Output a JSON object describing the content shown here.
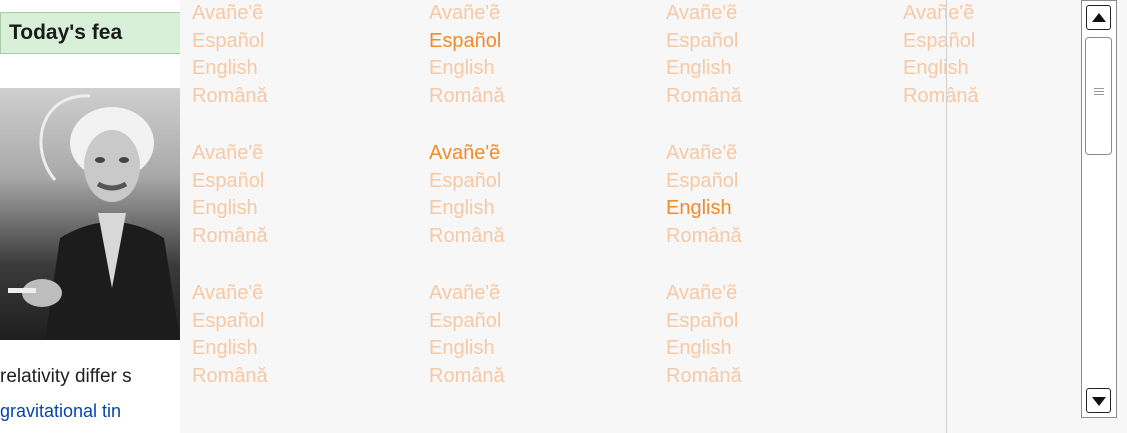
{
  "background": {
    "featured_title": "Today's fea",
    "article_text": "relativity differ s",
    "article_link": "gravitational tin"
  },
  "language_groups": [
    {
      "items": [
        {
          "label": "Avañe'ẽ",
          "active": false
        },
        {
          "label": "Español",
          "active": false
        },
        {
          "label": "English",
          "active": false
        },
        {
          "label": "Română",
          "active": false
        }
      ]
    },
    {
      "items": [
        {
          "label": "Avañe'ẽ",
          "active": false
        },
        {
          "label": "Español",
          "active": true
        },
        {
          "label": "English",
          "active": false
        },
        {
          "label": "Română",
          "active": false
        }
      ]
    },
    {
      "items": [
        {
          "label": "Avañe'ẽ",
          "active": false
        },
        {
          "label": "Español",
          "active": false
        },
        {
          "label": "English",
          "active": false
        },
        {
          "label": "Română",
          "active": false
        }
      ]
    },
    {
      "items": [
        {
          "label": "Avañe'ẽ",
          "active": false
        },
        {
          "label": "Español",
          "active": false
        },
        {
          "label": "English",
          "active": false
        },
        {
          "label": "Română",
          "active": false
        }
      ]
    },
    {
      "items": [
        {
          "label": "Avañe'ẽ",
          "active": false
        },
        {
          "label": "Español",
          "active": false
        },
        {
          "label": "English",
          "active": false
        },
        {
          "label": "Română",
          "active": false
        }
      ]
    },
    {
      "items": [
        {
          "label": "Avañe'ẽ",
          "active": true
        },
        {
          "label": "Español",
          "active": false
        },
        {
          "label": "English",
          "active": false
        },
        {
          "label": "Română",
          "active": false
        }
      ]
    },
    {
      "items": [
        {
          "label": "Avañe'ẽ",
          "active": false
        },
        {
          "label": "Español",
          "active": false
        },
        {
          "label": "English",
          "active": true
        },
        {
          "label": "Română",
          "active": false
        }
      ]
    },
    {
      "items": [
        {
          "label": "Avañe'ẽ",
          "active": false
        },
        {
          "label": "Español",
          "active": false
        },
        {
          "label": "English",
          "active": false
        },
        {
          "label": "Română",
          "active": false
        }
      ]
    },
    {
      "items": [
        {
          "label": "Avañe'ẽ",
          "active": false
        },
        {
          "label": "Español",
          "active": false
        },
        {
          "label": "English",
          "active": false
        },
        {
          "label": "Română",
          "active": false
        }
      ]
    },
    {
      "items": [
        {
          "label": "Avañe'ẽ",
          "active": false
        },
        {
          "label": "Español",
          "active": false
        },
        {
          "label": "English",
          "active": false
        },
        {
          "label": "Română",
          "active": false
        }
      ]
    }
  ],
  "scrollbar": {
    "up_icon": "triangle-up-icon",
    "down_icon": "triangle-down-icon",
    "thumb_icon": "grip-lines-icon",
    "position": 0
  },
  "colors": {
    "inactive_text": "#f7c8a4",
    "active_text": "#f08c2c",
    "popup_bg": "#f7f7f7",
    "link": "#0645ad",
    "featured_bar": "#d8f0d8"
  }
}
